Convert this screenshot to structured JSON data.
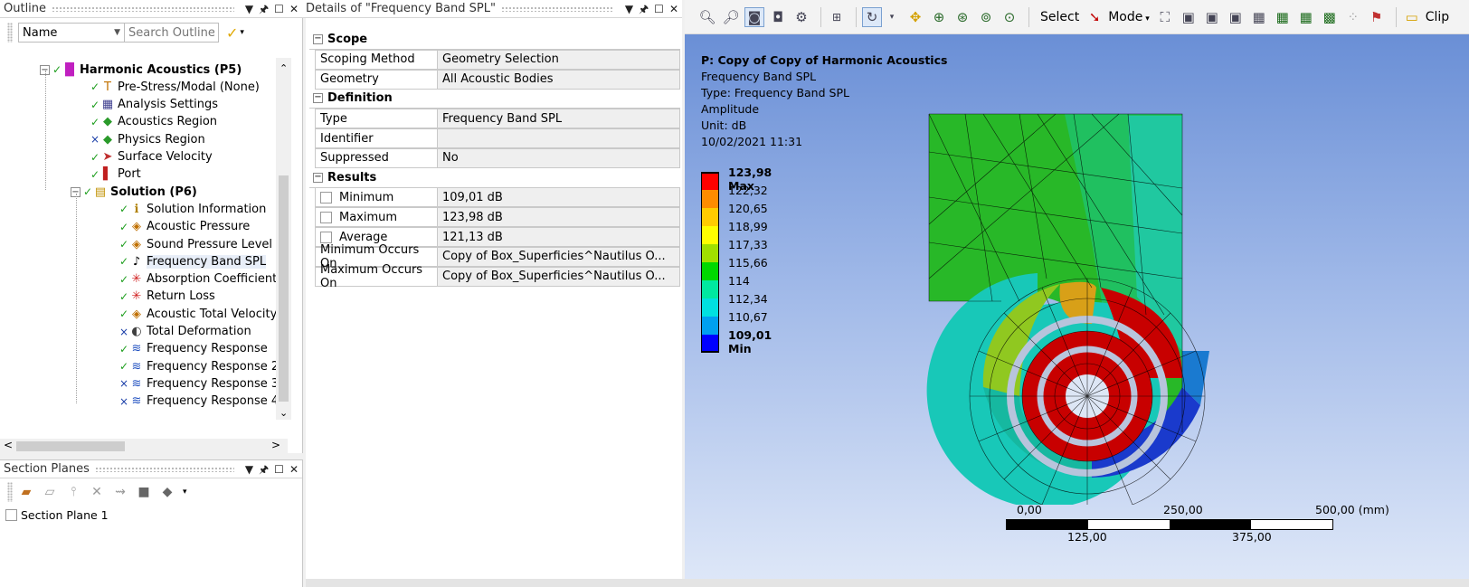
{
  "outline": {
    "title": "Outline",
    "filter_label": "Name",
    "search_placeholder": "Search Outline",
    "tree": [
      {
        "label": "Harmonic Acoustics (P5)",
        "icon": "harmonic-icon",
        "bold": true,
        "status": "check",
        "expanded": true
      },
      {
        "label": "Pre-Stress/Modal (None)",
        "icon": "prestress-icon",
        "status": "check"
      },
      {
        "label": "Analysis Settings",
        "icon": "analysis-settings-icon",
        "status": "check"
      },
      {
        "label": "Acoustics Region",
        "icon": "region-icon",
        "status": "check"
      },
      {
        "label": "Physics Region",
        "icon": "region-icon",
        "status": "x"
      },
      {
        "label": "Surface Velocity",
        "icon": "velocity-icon",
        "status": "check"
      },
      {
        "label": "Port",
        "icon": "port-icon",
        "status": "check"
      },
      {
        "label": "Solution (P6)",
        "icon": "solution-icon",
        "bold": true,
        "status": "check",
        "expanded": true
      },
      {
        "label": "Solution Information",
        "icon": "solution-info-icon",
        "status": "check"
      },
      {
        "label": "Acoustic Pressure",
        "icon": "result-icon",
        "status": "check"
      },
      {
        "label": "Sound Pressure Level",
        "icon": "result-icon",
        "status": "check"
      },
      {
        "label": "Frequency Band SPL",
        "icon": "music-note-icon",
        "status": "check",
        "selected": true
      },
      {
        "label": "Absorption Coefficient",
        "icon": "star-burst-icon",
        "status": "check"
      },
      {
        "label": "Return Loss",
        "icon": "star-burst-icon",
        "status": "check"
      },
      {
        "label": "Acoustic Total Velocity",
        "icon": "result-icon",
        "status": "check"
      },
      {
        "label": "Total Deformation",
        "icon": "deformation-icon",
        "status": "x"
      },
      {
        "label": "Frequency Response",
        "icon": "frequency-response-icon",
        "status": "check"
      },
      {
        "label": "Frequency Response 2",
        "icon": "frequency-response-icon",
        "status": "check"
      },
      {
        "label": "Frequency Response 3",
        "icon": "frequency-response-icon",
        "status": "x"
      },
      {
        "label": "Frequency Response 4",
        "icon": "frequency-response-icon",
        "status": "x"
      }
    ]
  },
  "section_planes": {
    "title": "Section Planes",
    "items": [
      {
        "label": "Section Plane 1",
        "checked": false
      }
    ]
  },
  "details": {
    "title": "Details of \"Frequency Band SPL\"",
    "groups": [
      {
        "name": "Scope",
        "rows": [
          {
            "key": "Scoping Method",
            "value": "Geometry Selection"
          },
          {
            "key": "Geometry",
            "value": "All Acoustic Bodies"
          }
        ]
      },
      {
        "name": "Definition",
        "rows": [
          {
            "key": "Type",
            "value": "Frequency Band SPL"
          },
          {
            "key": "Identifier",
            "value": ""
          },
          {
            "key": "Suppressed",
            "value": "No"
          }
        ]
      },
      {
        "name": "Results",
        "rows": [
          {
            "key": "Minimum",
            "value": "109,01 dB",
            "checkbox": true
          },
          {
            "key": "Maximum",
            "value": "123,98 dB",
            "checkbox": true
          },
          {
            "key": "Average",
            "value": "121,13 dB",
            "checkbox": true
          },
          {
            "key": "Minimum Occurs On",
            "value": "Copy of Box_Superficies^Nautilus O..."
          },
          {
            "key": "Maximum Occurs On",
            "value": "Copy of Box_Superficies^Nautilus O..."
          }
        ]
      }
    ]
  },
  "toolbar": {
    "select_label": "Select",
    "mode_label": "Mode",
    "clip_label": "Clip"
  },
  "viewport": {
    "info": {
      "title": "P: Copy of Copy of Harmonic Acoustics",
      "result": "Frequency Band SPL",
      "type": "Type: Frequency Band SPL",
      "mode": "Amplitude",
      "unit": "Unit: dB",
      "timestamp": "10/02/2021 11:31"
    },
    "legend": [
      {
        "label": "123,98 Max",
        "color": "#ff0000",
        "bold": true
      },
      {
        "label": "122,32",
        "color": "#ff8c00"
      },
      {
        "label": "120,65",
        "color": "#ffcc00"
      },
      {
        "label": "118,99",
        "color": "#ffff00"
      },
      {
        "label": "117,33",
        "color": "#a0e000"
      },
      {
        "label": "115,66",
        "color": "#00d800"
      },
      {
        "label": "114",
        "color": "#00e8a0"
      },
      {
        "label": "112,34",
        "color": "#00e0e0"
      },
      {
        "label": "110,67",
        "color": "#00a0f0"
      },
      {
        "label": "109,01 Min",
        "color": "#0000ff",
        "bold": true
      }
    ],
    "scale_bar": {
      "top_labels": [
        "0,00",
        "250,00",
        "500,00 (mm)"
      ],
      "bottom_labels": [
        "125,00",
        "375,00"
      ]
    }
  }
}
